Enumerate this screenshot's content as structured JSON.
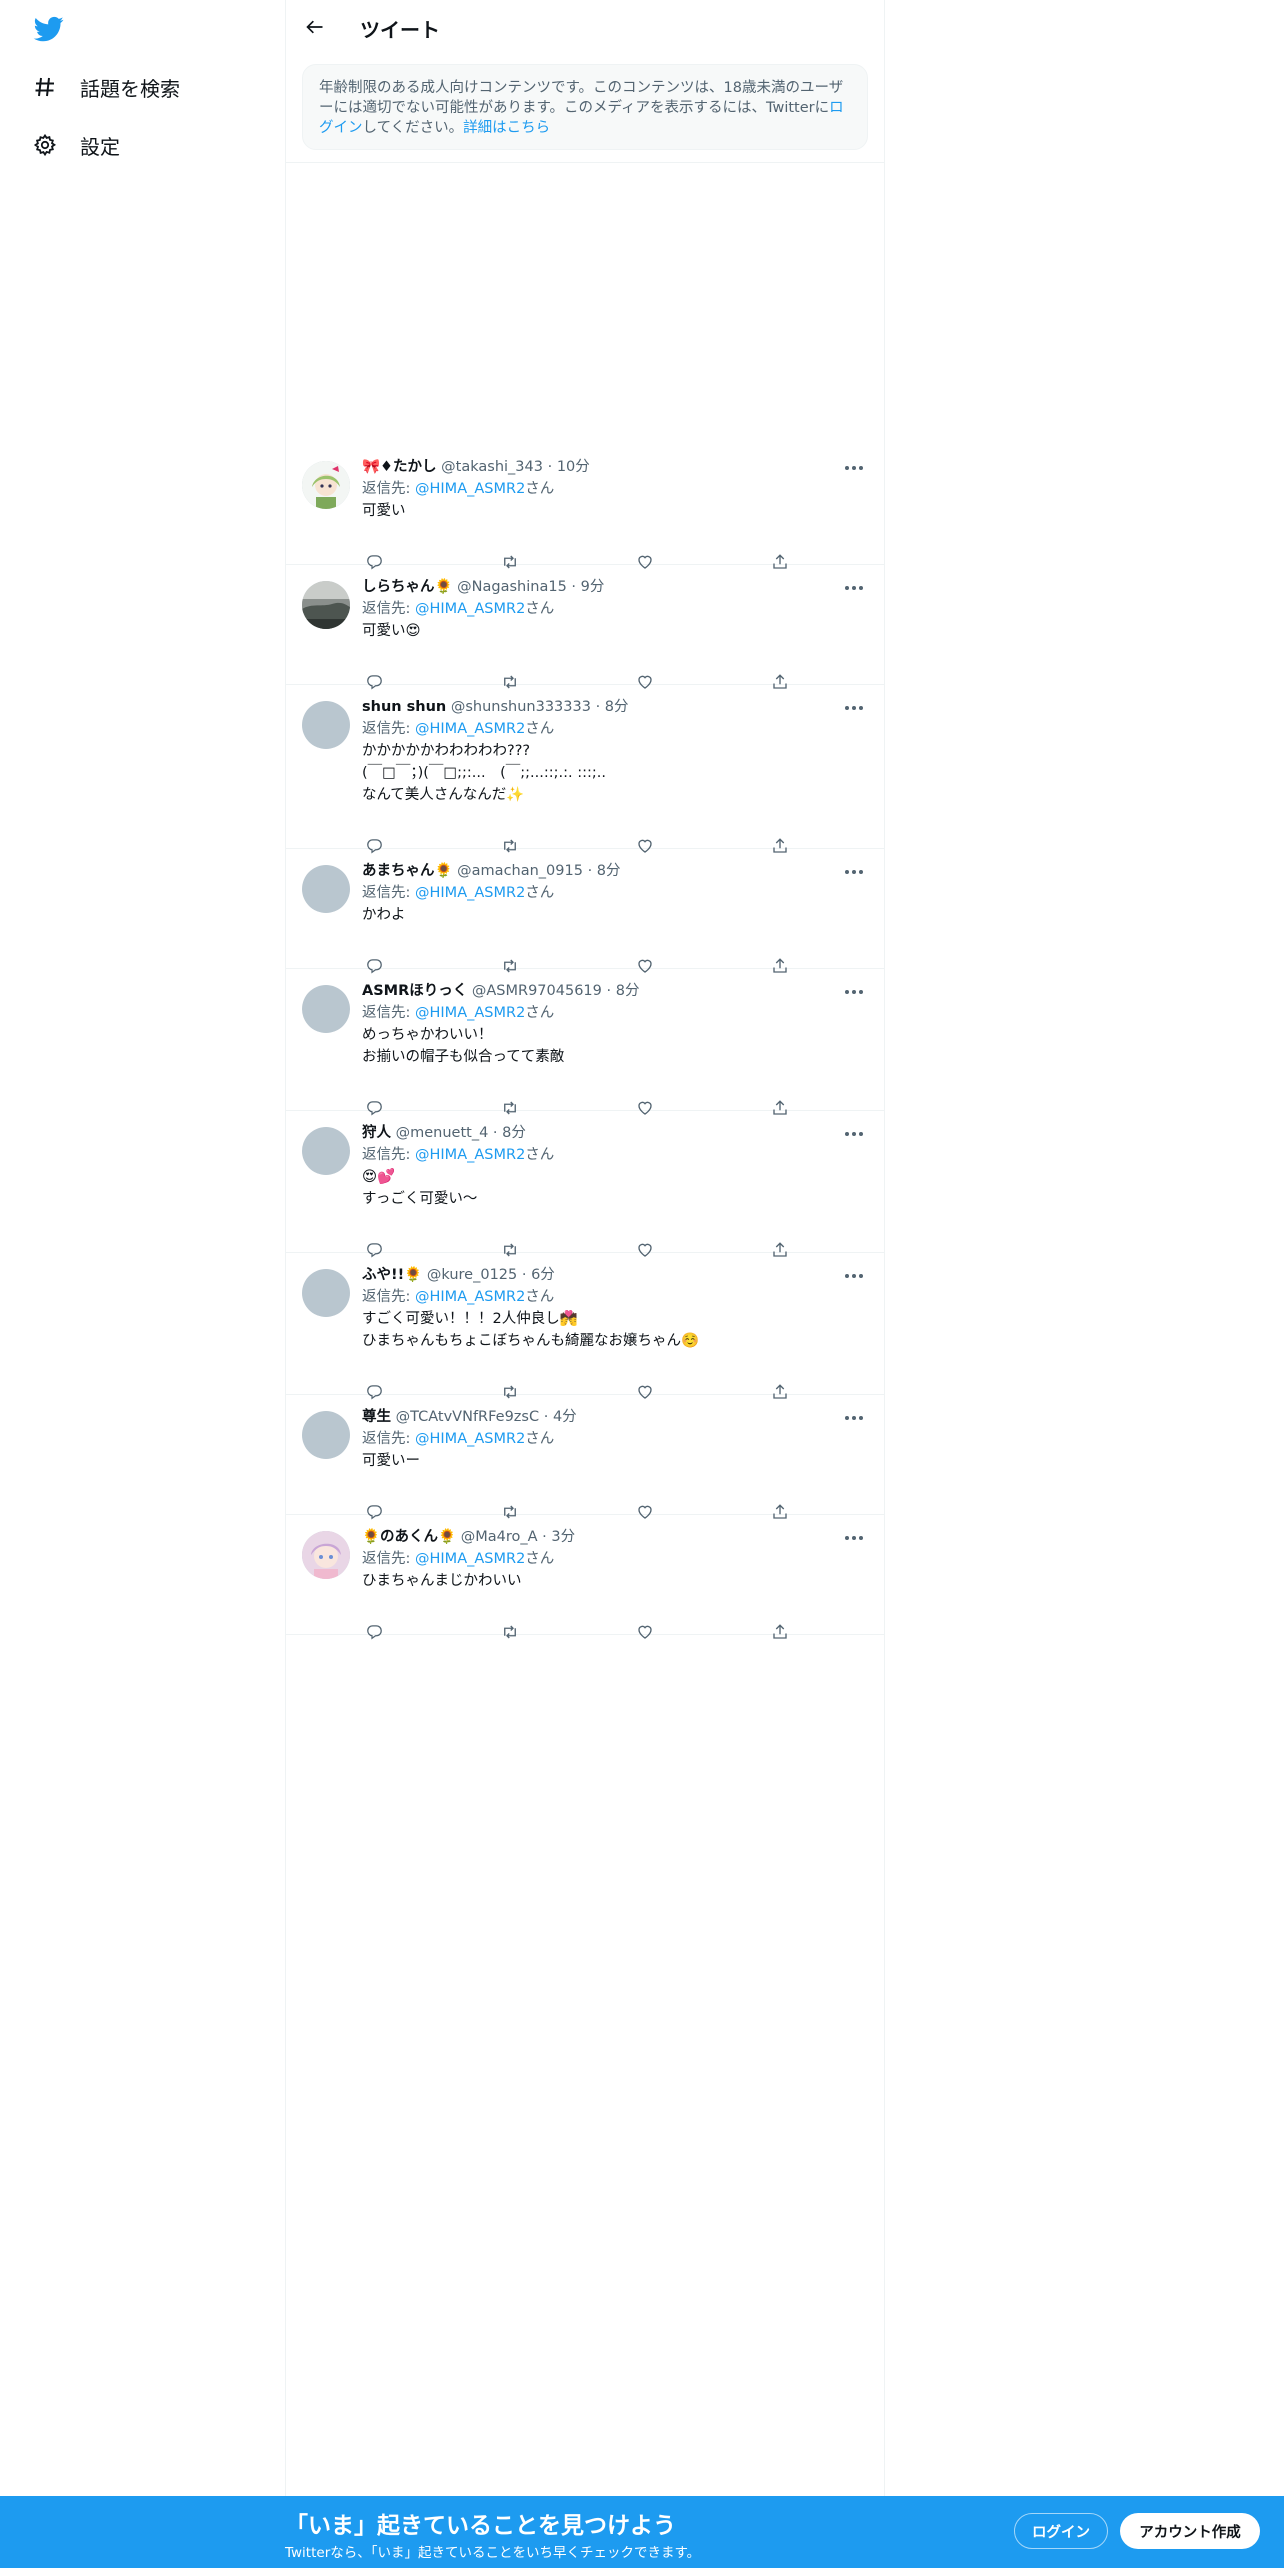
{
  "colors": {
    "brand": "#1d9bf0",
    "text": "#0f1419",
    "secondary": "#536471",
    "border": "#eff3f4"
  },
  "nav": {
    "logo_icon": "twitter-bird-icon",
    "items": [
      {
        "label": "話題を検索",
        "icon": "hashtag-icon"
      },
      {
        "label": "設定",
        "icon": "gear-icon"
      }
    ]
  },
  "header": {
    "title": "ツイート",
    "back_icon": "arrow-left-icon"
  },
  "notice": {
    "text_1": "年齢制限のある成人向けコンテンツです。このコンテンツは、18歳未満のユーザーには適切でない可能性があります。このメディアを表示するには、Twitterに",
    "login_link": "ログイン",
    "text_2": "してください。",
    "learn_more_link": "詳細はこちら"
  },
  "reply_prefix": "返信先: ",
  "reply_suffix": "さん",
  "tweets": [
    {
      "name": "🎀♦たかし",
      "handle": "@takashi_343",
      "time": "10分",
      "reply_to": "@HIMA_ASMR2",
      "text": "可愛い",
      "avatar": "anime-girl"
    },
    {
      "name": "しらちゃん🌻",
      "handle": "@Nagashina15",
      "time": "9分",
      "reply_to": "@HIMA_ASMR2",
      "text": "可愛い😍",
      "avatar": "landscape"
    },
    {
      "name": "shun shun",
      "handle": "@shunshun333333",
      "time": "8分",
      "reply_to": "@HIMA_ASMR2",
      "text": "かかかかかわわわわわ???\n(￣□￣；)(￣□;;:...　(￣;;...::;.:. :::;..\nなんて美人さんなんだ✨",
      "avatar": "default"
    },
    {
      "name": "あまちゃん🌻",
      "handle": "@amachan_0915",
      "time": "8分",
      "reply_to": "@HIMA_ASMR2",
      "text": "かわよ",
      "avatar": "default"
    },
    {
      "name": "ASMRほりっく",
      "handle": "@ASMR97045619",
      "time": "8分",
      "reply_to": "@HIMA_ASMR2",
      "text": "めっちゃかわいい！\nお揃いの帽子も似合ってて素敵",
      "avatar": "default"
    },
    {
      "name": "狩人",
      "handle": "@menuett_4",
      "time": "8分",
      "reply_to": "@HIMA_ASMR2",
      "text": "😍💕\nすっごく可愛い〜",
      "avatar": "default"
    },
    {
      "name": "ふや!!🌻",
      "handle": "@kure_0125",
      "time": "6分",
      "reply_to": "@HIMA_ASMR2",
      "text": "すごく可愛い！！！2人仲良し💏\nひまちゃんもちょこぼちゃんも綺麗なお嬢ちゃん☺️",
      "avatar": "default"
    },
    {
      "name": "尊生",
      "handle": "@TCAtvVNfRFe9zsC",
      "time": "4分",
      "reply_to": "@HIMA_ASMR2",
      "text": "可愛いー",
      "avatar": "default"
    },
    {
      "name": "🌻のあくん🌻",
      "handle": "@Ma4ro_A",
      "time": "3分",
      "reply_to": "@HIMA_ASMR2",
      "text": "ひまちゃんまじかわいい",
      "avatar": "anime-pink"
    }
  ],
  "bottom_bar": {
    "title": "「いま」起きていることを見つけよう",
    "subtitle": "Twitterなら、「いま」起きていることをいち早くチェックできます。",
    "login": "ログイン",
    "signup": "アカウント作成"
  }
}
